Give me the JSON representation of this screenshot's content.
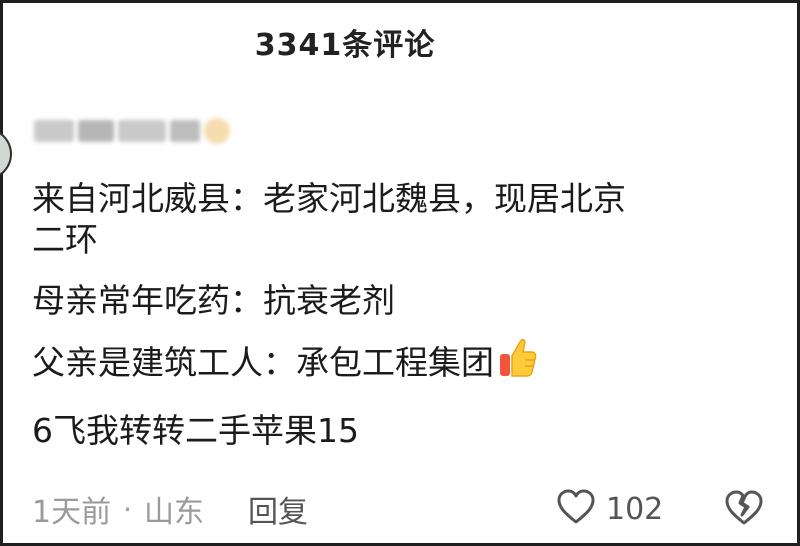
{
  "header": {
    "title": "3341条评论"
  },
  "comment": {
    "lines": [
      "来自河北威县：老家河北魏县，现居北京",
      "二环",
      "母亲常年吃药：抗衰老剂",
      "父亲是建筑工人：承包工程集团",
      "6飞我转转二手苹果15"
    ],
    "emoji_icon": "thumbs-up-icon"
  },
  "footer": {
    "time": "1天前",
    "location": "山东",
    "reply_label": "回复",
    "like_count": "102",
    "like_icon": "heart-outline-icon",
    "dislike_icon": "broken-heart-icon"
  },
  "colors": {
    "text": "#1b1b1b",
    "meta": "#9a9a9a",
    "icon": "#555555"
  }
}
